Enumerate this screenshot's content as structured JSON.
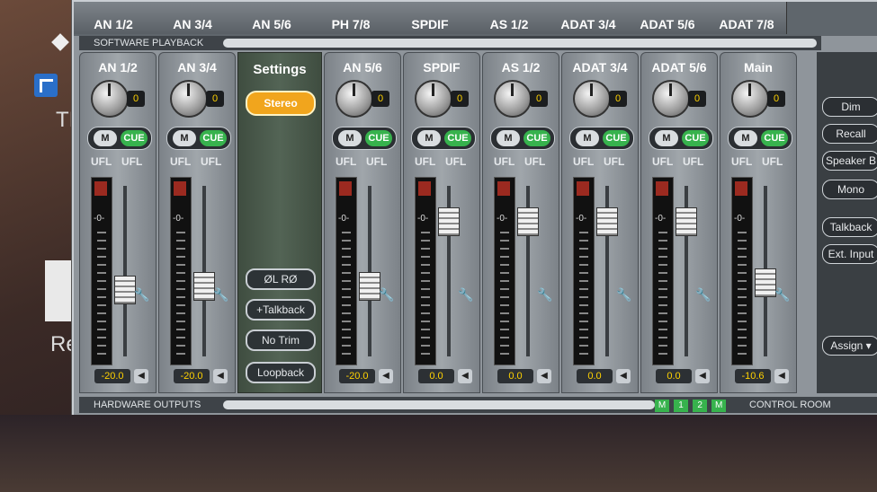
{
  "desktop": {
    "text_ti": "TI",
    "text_ren": "Ren"
  },
  "top_tabs": [
    "AN 1/2",
    "AN 3/4",
    "AN 5/6",
    "PH 7/8",
    "SPDIF",
    "AS 1/2",
    "ADAT 3/4",
    "ADAT 5/6",
    "ADAT 7/8"
  ],
  "software_playback_label": "SOFTWARE PLAYBACK",
  "settings": {
    "title": "Settings",
    "stereo": "Stereo",
    "phase": "ØL RØ",
    "talkback": "+Talkback",
    "no_trim": "No Trim",
    "loopback": "Loopback"
  },
  "channels": [
    {
      "name": "AN 1/2",
      "gain": "0",
      "mute": "M",
      "cue": "CUE",
      "ufl1": "UFL",
      "ufl2": "UFL",
      "zero": "-0-",
      "readout": "-20.0"
    },
    {
      "name": "AN 3/4",
      "gain": "0",
      "mute": "M",
      "cue": "CUE",
      "ufl1": "UFL",
      "ufl2": "UFL",
      "zero": "-0-",
      "readout": "-20.0"
    },
    {
      "name": "AN 5/6",
      "gain": "0",
      "mute": "M",
      "cue": "CUE",
      "ufl1": "UFL",
      "ufl2": "UFL",
      "zero": "-0-",
      "readout": "-20.0"
    },
    {
      "name": "SPDIF",
      "gain": "0",
      "mute": "M",
      "cue": "CUE",
      "ufl1": "UFL",
      "ufl2": "UFL",
      "zero": "-0-",
      "readout": "0.0"
    },
    {
      "name": "AS 1/2",
      "gain": "0",
      "mute": "M",
      "cue": "CUE",
      "ufl1": "UFL",
      "ufl2": "UFL",
      "zero": "-0-",
      "readout": "0.0"
    },
    {
      "name": "ADAT 3/4",
      "gain": "0",
      "mute": "M",
      "cue": "CUE",
      "ufl1": "UFL",
      "ufl2": "UFL",
      "zero": "-0-",
      "readout": "0.0"
    },
    {
      "name": "ADAT 5/6",
      "gain": "0",
      "mute": "M",
      "cue": "CUE",
      "ufl1": "UFL",
      "ufl2": "UFL",
      "zero": "-0-",
      "readout": "0.0"
    },
    {
      "name": "Main",
      "gain": "0",
      "mute": "M",
      "cue": "CUE",
      "ufl1": "UFL",
      "ufl2": "UFL",
      "zero": "-0-",
      "readout": "-10.6"
    }
  ],
  "right_panel": {
    "dim": "Dim",
    "recall": "Recall",
    "speaker_b": "Speaker B",
    "mono": "Mono",
    "talkback": "Talkback",
    "ext_input": "Ext. Input",
    "assign": "Assign ▾"
  },
  "hardware_outputs_label": "HARDWARE OUTPUTS",
  "hw_nums": [
    "M",
    "1",
    "2",
    "M"
  ],
  "control_room_label": "CONTROL ROOM",
  "icons": {
    "wrench": "wrench-icon",
    "pan": "pan-arrow-icon",
    "shortcut": "shortcut-icon"
  },
  "colors": {
    "cue_green": "#37b24d",
    "stereo_orange": "#f1a51d",
    "value_yellow": "#ffd200"
  }
}
